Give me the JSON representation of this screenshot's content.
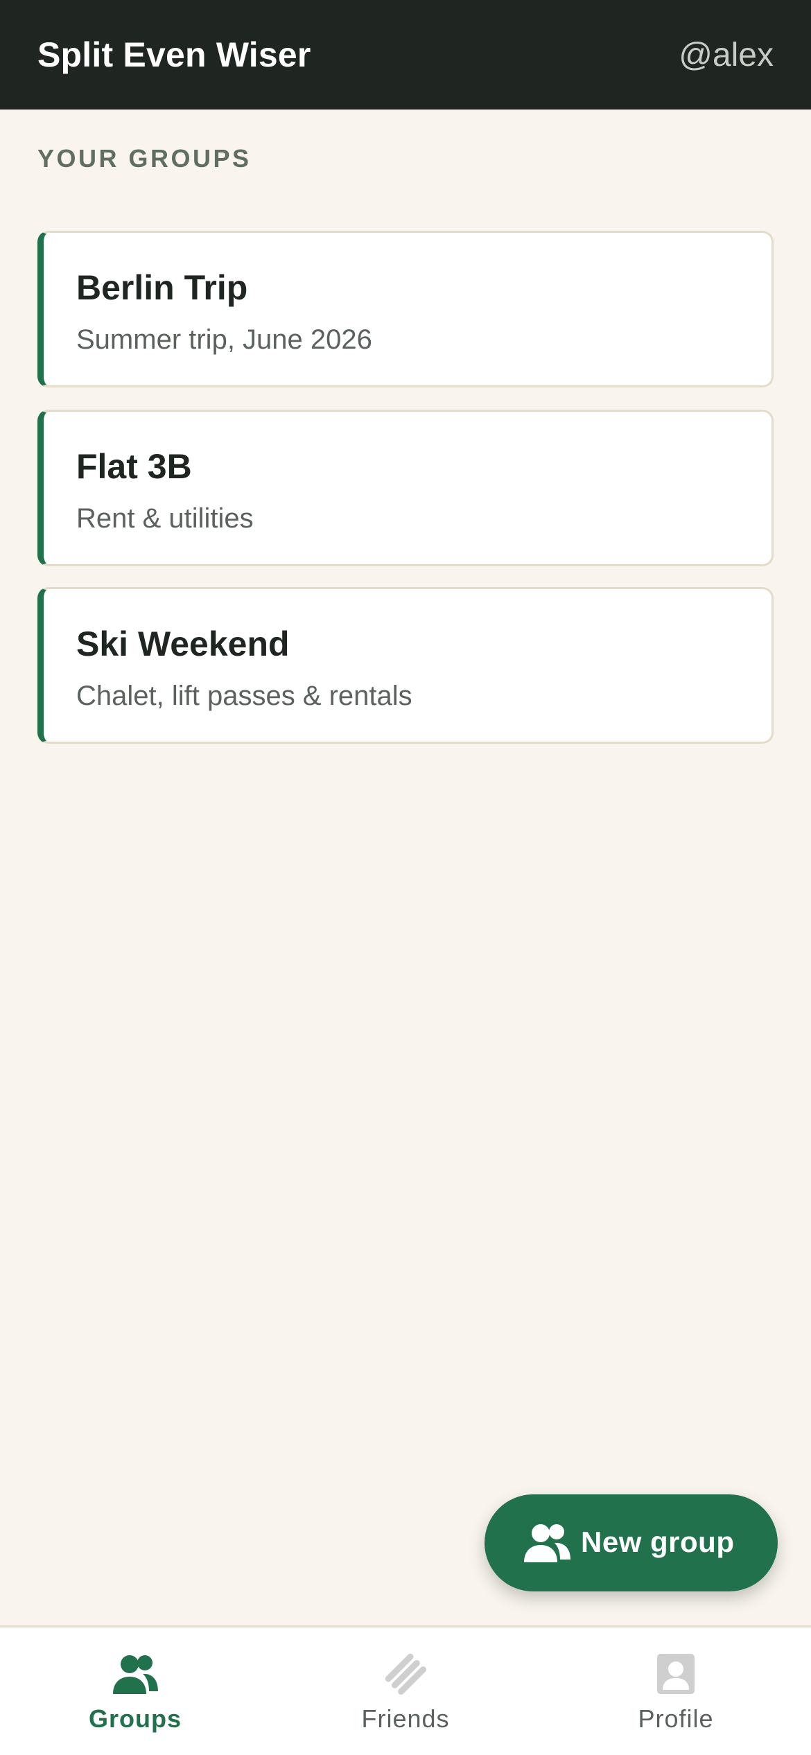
{
  "header": {
    "title": "Split Even Wiser",
    "user_handle": "@alex"
  },
  "section": {
    "heading": "YOUR GROUPS"
  },
  "groups": [
    {
      "name": "Berlin Trip",
      "description": "Summer trip, June 2026"
    },
    {
      "name": "Flat 3B",
      "description": "Rent & utilities"
    },
    {
      "name": "Ski Weekend",
      "description": "Chalet, lift passes & rentals"
    }
  ],
  "fab": {
    "label": "New group",
    "icon": "users-icon"
  },
  "bottom_nav": {
    "items": [
      {
        "label": "Groups",
        "icon": "users-icon",
        "active": true
      },
      {
        "label": "Friends",
        "icon": "handshake-icon",
        "active": false
      },
      {
        "label": "Profile",
        "icon": "profile-icon",
        "active": false
      }
    ]
  },
  "colors": {
    "header_bg": "#1f2621",
    "accent": "#22714d",
    "page_bg": "#f9f5ee",
    "inactive_icon": "#cfcfcf"
  }
}
